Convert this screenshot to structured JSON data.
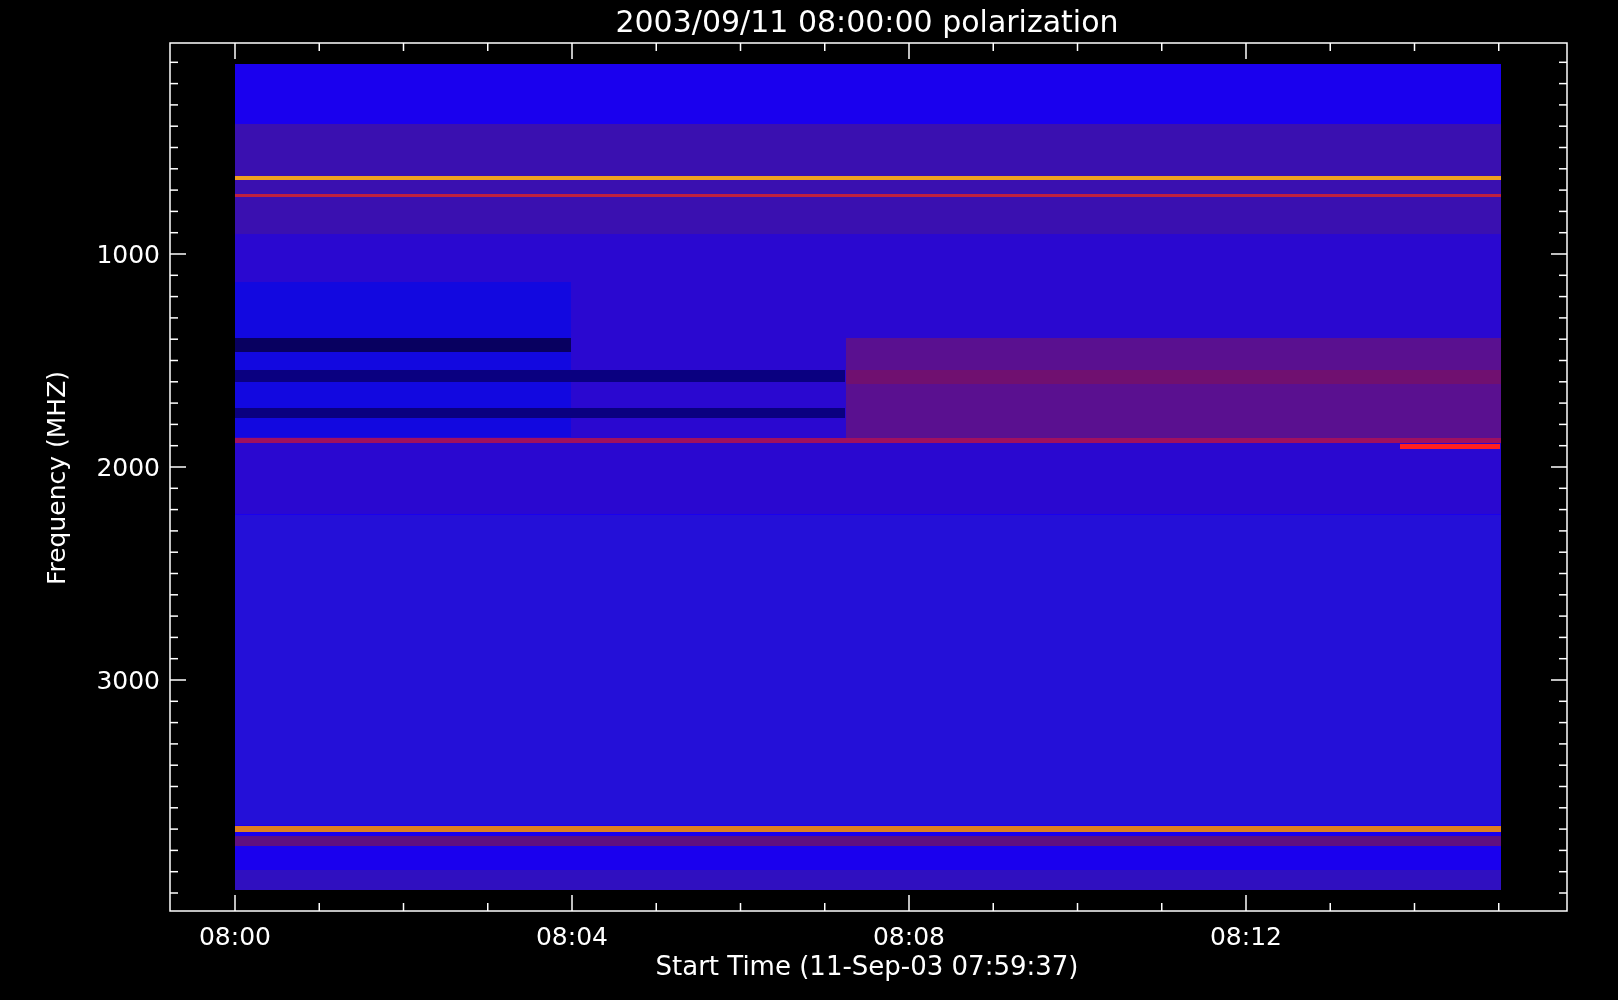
{
  "plot": {
    "title": "2003/09/11 08:00:00 polarization",
    "xlabel": "Start Time (11-Sep-03 07:59:37)",
    "ylabel": "Frequency (MHZ)",
    "xticks": [
      "08:00",
      "08:04",
      "08:08",
      "08:12"
    ],
    "yticks": [
      "1000",
      "2000",
      "3000"
    ]
  }
}
